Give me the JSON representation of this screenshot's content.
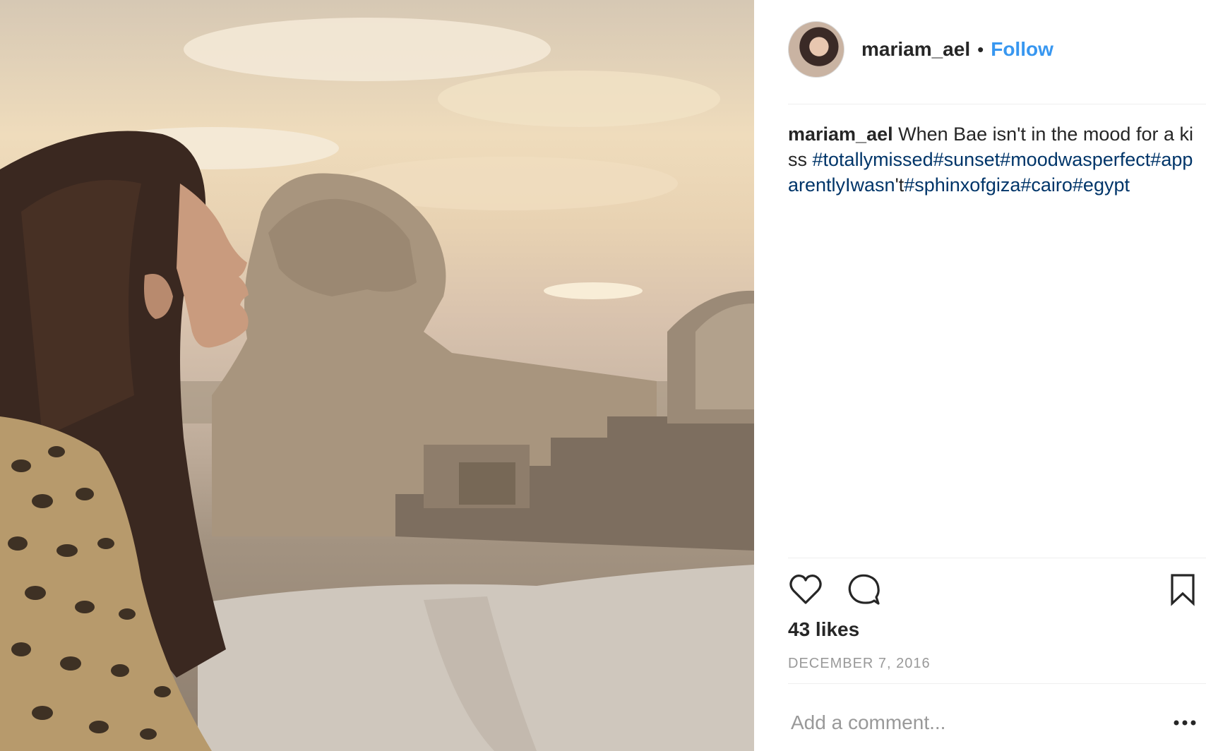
{
  "post": {
    "username": "mariam_ael",
    "separator": "•",
    "follow_label": "Follow",
    "caption": {
      "username": "mariam_ael",
      "text": " When Bae isn't in the mood for a kiss ",
      "hashtags_before": [
        "#totallymissed",
        "#sunset",
        "#moodwasperfect",
        "#apparentlyIwasn"
      ],
      "apostrophe": "'t",
      "hashtags_after": [
        "#sphinxofgiza",
        "#cairo",
        "#egypt"
      ]
    },
    "likes": "43 likes",
    "date": "DECEMBER 7, 2016",
    "comment": {
      "placeholder": "Add a comment..."
    }
  },
  "icons": {
    "like": "heart-icon",
    "comment": "comment-bubble-icon",
    "save": "bookmark-icon",
    "more": "more-options-icon"
  },
  "colors": {
    "follow": "#3897f0",
    "hashtag": "#003569",
    "text": "#262626",
    "muted": "#999999"
  }
}
